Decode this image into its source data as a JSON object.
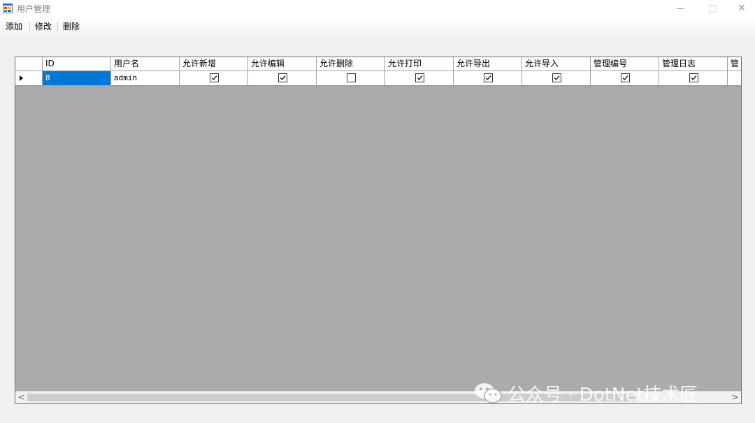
{
  "window": {
    "title": "用户管理",
    "minimize_glyph": "",
    "maximize_glyph": "",
    "close_glyph": "✕"
  },
  "menu": {
    "add": "添加",
    "edit": "修改",
    "delete": "删除"
  },
  "grid": {
    "columns": [
      "ID",
      "用户名",
      "允许新增",
      "允许编辑",
      "允许删除",
      "允许打印",
      "允许导出",
      "允许导入",
      "管理编号",
      "管理日志",
      "管"
    ],
    "rows": [
      {
        "id": "8",
        "username": "admin",
        "checks": [
          true,
          true,
          false,
          true,
          true,
          true,
          true,
          true
        ]
      }
    ]
  },
  "scrollbar": {
    "left_arrow": "<",
    "right_arrow": ">"
  },
  "watermark": {
    "text": "公众号 · DotNet技术匠"
  },
  "colors": {
    "selection": "#0078d7",
    "grid_background": "#ababab"
  }
}
